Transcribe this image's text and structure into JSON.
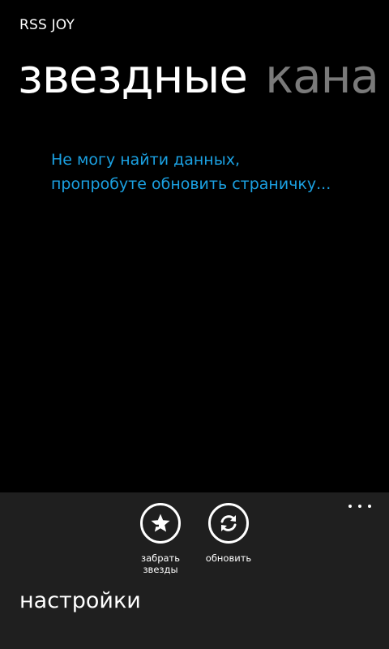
{
  "app": {
    "title": "RSS JOY"
  },
  "pivot": {
    "items": [
      {
        "label": "звездные",
        "state": "active"
      },
      {
        "label": "кана",
        "state": "inactive"
      }
    ],
    "active_color": "#ffffff",
    "inactive_color": "#7a7a7a"
  },
  "content": {
    "message_line1": "Не могу найти данных,",
    "message_line2": "пропробуте обновить страничку...",
    "message_color": "#1ba1e2"
  },
  "appbar": {
    "background": "#1f1f1f",
    "buttons": [
      {
        "icon": "star-remove-icon",
        "label": "забрать\nзвезды"
      },
      {
        "icon": "refresh-icon",
        "label": "обновить"
      }
    ],
    "more_icon": "ellipsis-icon",
    "menu_items": [
      {
        "label": "настройки"
      }
    ]
  }
}
